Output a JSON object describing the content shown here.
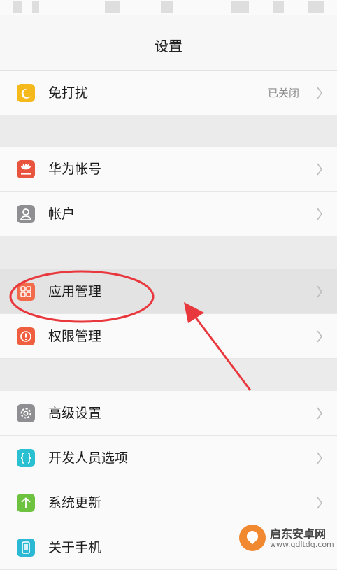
{
  "header": {
    "title": "设置"
  },
  "rows": [
    {
      "label": "免打扰",
      "value": "已关闭",
      "icon": "moon-icon",
      "color": "#f6b91c"
    },
    {
      "label": "华为帐号",
      "icon": "huawei-logo-icon",
      "color": "#e8543d"
    },
    {
      "label": "帐户",
      "icon": "account-icon",
      "color": "#8e8e93"
    },
    {
      "label": "应用管理",
      "icon": "app-grid-icon",
      "color": "#f26b4b"
    },
    {
      "label": "权限管理",
      "icon": "permission-icon",
      "color": "#ef5f3f"
    },
    {
      "label": "高级设置",
      "icon": "gear-icon",
      "color": "#8e8e93"
    },
    {
      "label": "开发人员选项",
      "icon": "braces-icon",
      "color": "#2ac0d2"
    },
    {
      "label": "系统更新",
      "icon": "arrow-up-icon",
      "color": "#6dc23f"
    },
    {
      "label": "关于手机",
      "icon": "phone-icon",
      "color": "#2bb8d4"
    }
  ],
  "annotation": {
    "highlighted_row": "应用管理",
    "color": "#e8383d"
  },
  "watermark": {
    "name": "启东安卓网",
    "url": "www.qdltdq.com"
  }
}
